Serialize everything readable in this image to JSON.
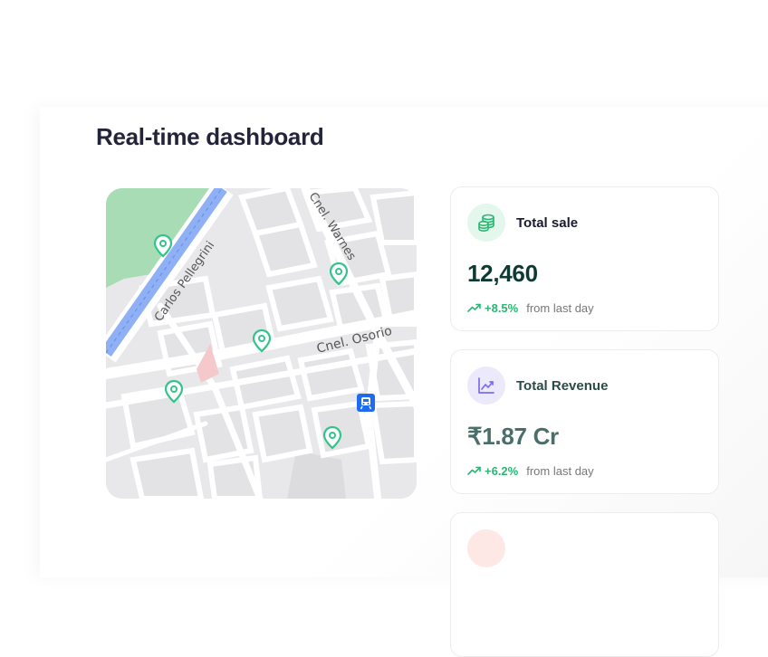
{
  "dashboard": {
    "title": "Real-time dashboard"
  },
  "map": {
    "streets": [
      "Carlos Pellegrini",
      "Cnel. Warnes",
      "Cnel. Osorio"
    ],
    "pin_color": "#34c48b",
    "transit_color": "#1f6bf0"
  },
  "cards": [
    {
      "label": "Total sale",
      "value": "12,460",
      "change": "+8.5%",
      "caption": "from last day",
      "icon": "coins-icon",
      "icon_bg": "#e3f7ec",
      "icon_color": "#2bb673",
      "label_color": "#1a1a2e",
      "value_color": "#0d3b34"
    },
    {
      "label": "Total Revenue",
      "value": "₹1.87 Cr",
      "change": "+6.2%",
      "caption": "from last day",
      "icon": "chart-line-icon",
      "icon_bg": "#ece9fb",
      "icon_color": "#7b6cf0",
      "label_color": "#2c4a48",
      "value_color": "#4a6e6a"
    },
    {
      "icon_bg": "#fde8e6"
    }
  ]
}
